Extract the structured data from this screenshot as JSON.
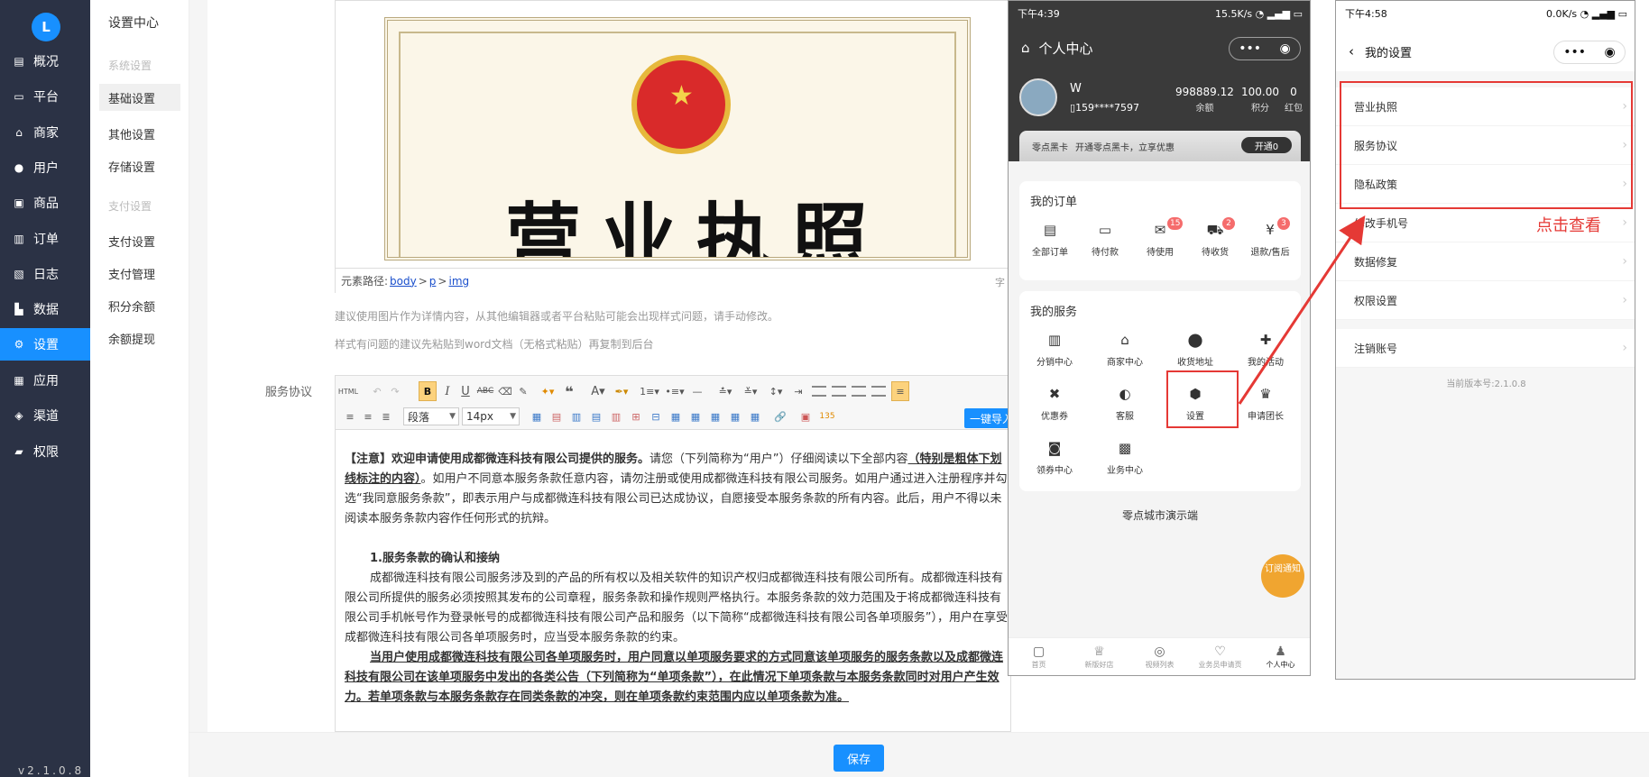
{
  "nav": {
    "logo": "L",
    "items": [
      {
        "label": "概况",
        "icon": "dashboard-icon"
      },
      {
        "label": "平台",
        "icon": "monitor-icon"
      },
      {
        "label": "商家",
        "icon": "store-icon"
      },
      {
        "label": "用户",
        "icon": "user-icon"
      },
      {
        "label": "商品",
        "icon": "product-icon"
      },
      {
        "label": "订单",
        "icon": "order-icon"
      },
      {
        "label": "日志",
        "icon": "log-icon"
      },
      {
        "label": "数据",
        "icon": "chart-icon"
      },
      {
        "label": "设置",
        "icon": "gear-icon",
        "active": true
      },
      {
        "label": "应用",
        "icon": "apps-icon"
      },
      {
        "label": "渠道",
        "icon": "channel-icon"
      },
      {
        "label": "权限",
        "icon": "lock-icon"
      }
    ],
    "version": "v2.1.0.8"
  },
  "subnav": {
    "title": "设置中心",
    "group1": "系统设置",
    "items1": [
      "基础设置",
      "其他设置",
      "存储设置"
    ],
    "group2": "支付设置",
    "items2": [
      "支付设置",
      "支付管理",
      "积分余额",
      "余额提现"
    ]
  },
  "editor1": {
    "image_title": "营业执照",
    "path_label": "元素路径:",
    "path": [
      "body",
      "p",
      "img"
    ],
    "word_count": "字"
  },
  "hints": {
    "line1": "建议使用图片作为详情内容，从其他编辑器或者平台粘贴可能会出现样式问题，请手动修改。",
    "line2": "样式有问题的建议先粘贴到word文档（无格式粘贴）再复制到后台"
  },
  "service_label": "服务协议",
  "editor2": {
    "paragraph_select": "段落",
    "fontsize_select": "14px",
    "import_button": "一键导入",
    "notice_lead": "【注意】欢迎申请使用成都微连科技有限公司提供的服务。",
    "notice_body": "请您（下列简称为“用户”）仔细阅读以下全部内容",
    "notice_bold": "（特别是粗体下划线标注的内容）",
    "notice_rest": "。如用户不同意本服务条款任意内容，请勿注册或使用成都微连科技有限公司服务。如用户通过进入注册程序并勾选“我同意服务条款”，即表示用户与成都微连科技有限公司已达成协议，自愿接受本服务条款的所有内容。此后，用户不得以未阅读本服务条款内容作任何形式的抗辩。",
    "section1": "1.服务条款的确认和接纳",
    "para1": "成都微连科技有限公司服务涉及到的产品的所有权以及相关软件的知识产权归成都微连科技有限公司所有。成都微连科技有限公司所提供的服务必须按照其发布的公司章程，服务条款和操作规则严格执行。本服务条款的效力范围及于将成都微连科技有限公司手机帐号作为登录帐号的成都微连科技有限公司产品和服务（以下简称“成都微连科技有限公司各单项服务”），用户在享受成都微连科技有限公司各单项服务时，应当受本服务条款的约束。",
    "para2": "当用户使用成都微连科技有限公司各单项服务时，用户同意以单项服务要求的方式同意该单项服务的服务条款以及成都微连科技有限公司在该单项服务中发出的各类公告（下列简称为“单项条款”），在此情况下单项条款与本服务条款同时对用户产生效力。若单项条款与本服务条款存在同类条款的冲突，则在单项条款约束范围内应以单项条款为准。"
  },
  "save_button": "保存",
  "phone1": {
    "status_time": "下午4:39",
    "status_right": "15.5K/s",
    "title": "个人中心",
    "capsule": [
      "•••",
      "◉"
    ],
    "user_name": "W",
    "user_phone": "159****7597",
    "stats": [
      {
        "value": "998889.12",
        "label": "余额"
      },
      {
        "value": "100.00",
        "label": "积分"
      },
      {
        "value": "0",
        "label": "红包"
      }
    ],
    "vip_label": "零点黑卡",
    "vip_text": "开通零点黑卡，立享优惠",
    "vip_button": "开通0",
    "orders_title": "我的订单",
    "orders": [
      {
        "label": "全部订单",
        "icon": "order-list-icon",
        "badge": ""
      },
      {
        "label": "待付款",
        "icon": "wallet-icon",
        "badge": ""
      },
      {
        "label": "待使用",
        "icon": "gift-icon",
        "badge": "15"
      },
      {
        "label": "待收货",
        "icon": "truck-icon",
        "badge": "2"
      },
      {
        "label": "退款/售后",
        "icon": "refund-icon",
        "badge": "3"
      }
    ],
    "services_title": "我的服务",
    "services": [
      {
        "label": "分销中心",
        "icon": "building-icon"
      },
      {
        "label": "商家中心",
        "icon": "shop-icon"
      },
      {
        "label": "收货地址",
        "icon": "location-icon"
      },
      {
        "label": "我的活动",
        "icon": "activity-icon"
      },
      {
        "label": "优惠券",
        "icon": "coupon-icon"
      },
      {
        "label": "客服",
        "icon": "service-icon"
      },
      {
        "label": "设置",
        "icon": "settings-icon"
      },
      {
        "label": "申请团长",
        "icon": "crown-icon"
      },
      {
        "label": "领券中心",
        "icon": "bag-icon"
      },
      {
        "label": "业务中心",
        "icon": "briefcase-icon"
      }
    ],
    "demo_text": "零点城市演示端",
    "subscribe": "订阅通知",
    "tabs": [
      {
        "label": "首页",
        "icon": "home-tab-icon"
      },
      {
        "label": "新版好店",
        "icon": "crown-tab-icon"
      },
      {
        "label": "视频列表",
        "icon": "video-tab-icon"
      },
      {
        "label": "业务员申请页",
        "icon": "apply-tab-icon"
      },
      {
        "label": "个人中心",
        "icon": "profile-tab-icon",
        "active": true
      }
    ]
  },
  "phone2": {
    "status_time": "下午4:58",
    "status_right": "0.0K/s",
    "title": "我的设置",
    "items": [
      "营业执照",
      "服务协议",
      "隐私政策",
      "修改手机号",
      "数据修复",
      "权限设置"
    ],
    "logout": "注销账号",
    "version": "当前版本号:2.1.0.8"
  },
  "annotation": "点击查看",
  "colors": {
    "primary": "#1890ff",
    "nav_bg": "#2b3245",
    "highlight": "#e53935"
  }
}
